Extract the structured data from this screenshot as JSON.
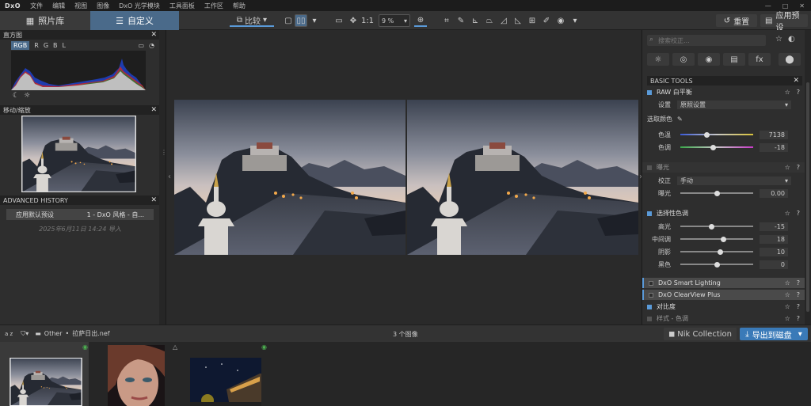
{
  "menubar": {
    "logo": "DxO",
    "items": [
      "文件",
      "编辑",
      "视图",
      "图像",
      "DxO 光学模块",
      "工具面板",
      "工作区",
      "帮助"
    ],
    "window_controls": [
      "—",
      "□",
      "✕"
    ]
  },
  "toolbar": {
    "library_tab": "照片库",
    "customize_tab": "自定义",
    "compare_label": "比较",
    "zoom_1to1": "1:1",
    "zoom_value": "9 %",
    "reset_label": "重置",
    "apply_preset_label": "应用预设"
  },
  "left": {
    "histogram": {
      "title": "直方图",
      "channels": [
        "RGB",
        "R",
        "G",
        "B",
        "L"
      ],
      "active_channel": "RGB"
    },
    "navigator": {
      "title": "移动/缩放"
    },
    "history": {
      "title": "ADVANCED HISTORY",
      "entry_name": "应用默认预设",
      "entry_value": "1 - DxO 风格 - 自...",
      "date": "2025年6月11日 14:24 导入"
    }
  },
  "right": {
    "search_placeholder": "搜索校正...",
    "category_icons": [
      "light-icon",
      "color-icon",
      "detail-icon",
      "geometry-icon",
      "effects-icon",
      "local-adjust-icon"
    ],
    "category_glyphs": [
      "☼",
      "◎",
      "◉",
      "▤",
      "fx",
      "⬤"
    ],
    "basic_tools_title": "BASIC TOOLS",
    "wb": {
      "title": "RAW 白平衡",
      "setting_label": "设置",
      "setting_value": "原照设置",
      "picker_label": "选取颜色",
      "temp_label": "色温",
      "temp_value": "7138",
      "tint_label": "色调",
      "tint_value": "-18",
      "temp_fraction": 0.36,
      "tint_fraction": 0.45
    },
    "exposure": {
      "title": "曝光",
      "mode_label": "校正",
      "mode_value": "手动",
      "exp_label": "曝光",
      "exp_value": "0.00",
      "exp_fraction": 0.5
    },
    "tone": {
      "title": "选择性色调",
      "rows": [
        {
          "label": "高光",
          "value": "-15",
          "fraction": 0.43
        },
        {
          "label": "中间调",
          "value": "18",
          "fraction": 0.59
        },
        {
          "label": "阴影",
          "value": "10",
          "fraction": 0.55
        },
        {
          "label": "黑色",
          "value": "0",
          "fraction": 0.5
        }
      ]
    },
    "smart_lighting": "DxO Smart Lighting",
    "clearview": "DxO ClearView Plus",
    "contrast": "对比度",
    "style_tone": "样式 - 色调"
  },
  "filmbar": {
    "sort_label": "a z",
    "folder_label": "Other",
    "file_name": "拉萨日出.nef",
    "count_label": "3 个图像",
    "nik_label": "Nik Collection",
    "export_label": "导出到磁盘"
  },
  "colors": {
    "accent": "#4a6a8a",
    "export": "#3a7ab8",
    "checkbox": "#5a9ad8"
  }
}
